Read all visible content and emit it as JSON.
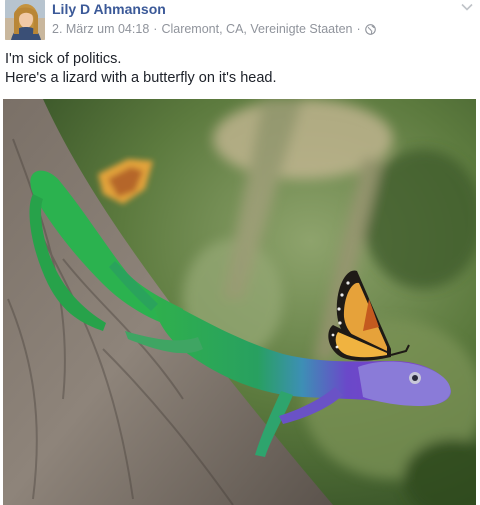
{
  "post": {
    "author": "Lily D Ahmanson",
    "date": "2. März um 04:18",
    "separator": "·",
    "location": "Claremont, CA, Vereinigte Staaten",
    "separator2": "·",
    "privacy_icon": "globe-icon",
    "menu_icon": "chevron-down-icon",
    "text_lines": [
      "I'm sick of politics.",
      "Here's a lizard with a butterfly on it's head."
    ],
    "photo_subject": "lizard-with-butterfly-photo"
  },
  "colors": {
    "author_link": "#3b5998",
    "meta_gray": "#90949c",
    "text": "#1d2129"
  }
}
